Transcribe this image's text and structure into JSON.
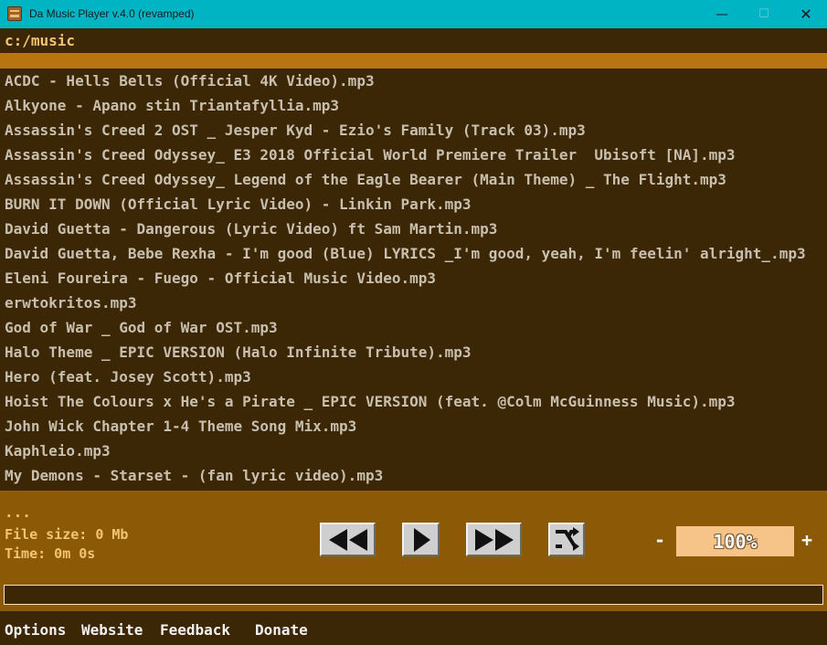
{
  "window": {
    "title": "Da Music Player v.4.0 (revamped)",
    "minimize_glyph": "—",
    "maximize_glyph": "☐",
    "close_glyph": "✕"
  },
  "path": "c:/music",
  "files": [
    "ACDC - Hells Bells (Official 4K Video).mp3",
    "Alkyone - Apano stin Triantafyllia.mp3",
    "Assassin's Creed 2 OST _ Jesper Kyd - Ezio's Family (Track 03).mp3",
    "Assassin's Creed Odyssey_ E3 2018 Official World Premiere Trailer  Ubisoft [NA].mp3",
    "Assassin's Creed Odyssey_ Legend of the Eagle Bearer (Main Theme) _ The Flight.mp3",
    "BURN IT DOWN (Official Lyric Video) - Linkin Park.mp3",
    "David Guetta - Dangerous (Lyric Video) ft Sam Martin.mp3",
    "David Guetta, Bebe Rexha - I'm good (Blue) LYRICS _I'm good, yeah, I'm feelin' alright_.mp3",
    "Eleni Foureira - Fuego - Official Music Video.mp3",
    "erwtokritos.mp3",
    "God of War _ God of War OST.mp3",
    "Halo Theme _ EPIC VERSION (Halo Infinite Tribute).mp3",
    "Hero (feat. Josey Scott).mp3",
    "Hoist The Colours x He's a Pirate _ EPIC VERSION (feat. @Colm McGuinness Music).mp3",
    "John Wick Chapter 1-4 Theme Song Mix.mp3",
    "Kaphleio.mp3",
    "My Demons - Starset - (fan lyric video).mp3"
  ],
  "now_playing": {
    "title": "...",
    "file_size": "File size: 0 Mb",
    "time": "Time: 0m 0s",
    "progress": 0
  },
  "controls": {
    "prev_icon": "previous-icon",
    "play_icon": "play-icon",
    "next_icon": "next-icon",
    "shuffle_icon": "shuffle-icon"
  },
  "volume": {
    "minus": "-",
    "value": "100%",
    "plus": "+"
  },
  "menu": {
    "options": "Options",
    "website": "Website",
    "feedback": "Feedback",
    "donate": "Donate"
  },
  "colors": {
    "titlebar": "#00b4c4",
    "background": "#3b2606",
    "panel": "#8c5a06",
    "selection": "#b87512",
    "text_list": "#c8bfae",
    "text_accent": "#f2c476",
    "volume_box": "#f6c488"
  }
}
